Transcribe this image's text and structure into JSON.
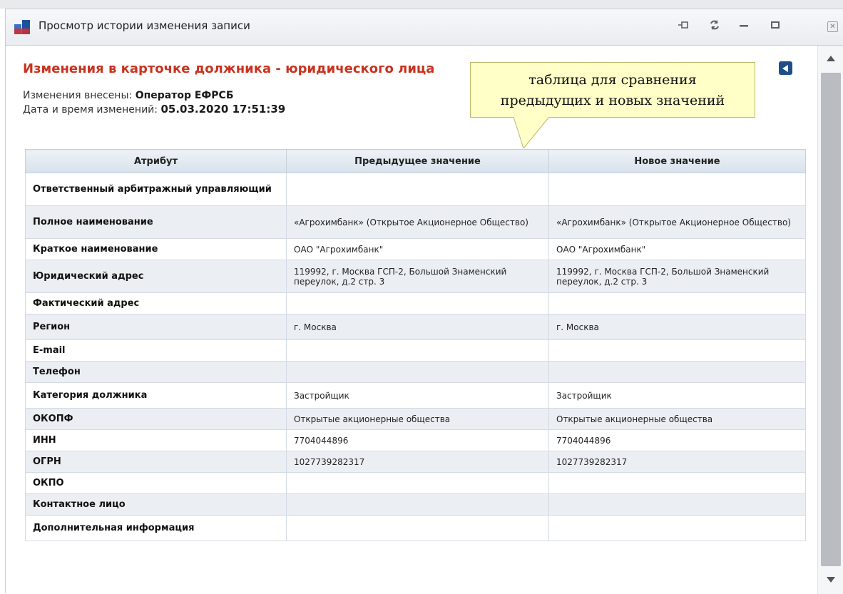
{
  "window": {
    "title": "Просмотр истории изменения записи",
    "buttons": [
      "pin-icon",
      "refresh-icon",
      "minimize-icon",
      "maximize-icon",
      "close-icon"
    ]
  },
  "content": {
    "heading": "Изменения в карточке должника - юридического лица",
    "changed_by_label": "Изменения внесены:",
    "changed_by_value": "Оператор ЕФРСБ",
    "datetime_label": "Дата и время изменений:",
    "datetime_value": "05.03.2020 17:51:39"
  },
  "callout": {
    "line1": "таблица для сравнения",
    "line2": "предыдущих и новых значений"
  },
  "table": {
    "headers": [
      "Атрибут",
      "Предыдущее значение",
      "Новое значение"
    ],
    "rows": [
      {
        "attr": "Ответственный арбитражный управляющий",
        "prev": "",
        "new": ""
      },
      {
        "attr": "Полное наименование",
        "prev": "«Агрохимбанк» (Открытое Акционерное Общество)",
        "new": "«Агрохимбанк» (Открытое Акционерное Общество)"
      },
      {
        "attr": "Краткое наименование",
        "prev": "ОАО \"Агрохимбанк\"",
        "new": "ОАО \"Агрохимбанк\""
      },
      {
        "attr": "Юридический адрес",
        "prev": "119992, г. Москва ГСП-2, Большой Знаменский переулок, д.2 стр. 3",
        "new": "119992, г. Москва ГСП-2, Большой Знаменский переулок, д.2 стр. 3"
      },
      {
        "attr": "Фактический адрес",
        "prev": "",
        "new": ""
      },
      {
        "attr": "Регион",
        "prev": "г. Москва",
        "new": "г. Москва"
      },
      {
        "attr": "E-mail",
        "prev": "",
        "new": ""
      },
      {
        "attr": "Телефон",
        "prev": "",
        "new": ""
      },
      {
        "attr": "Категория должника",
        "prev": "Застройщик",
        "new": "Застройщик"
      },
      {
        "attr": "ОКОПФ",
        "prev": "Открытые акционерные общества",
        "new": "Открытые акционерные общества"
      },
      {
        "attr": "ИНН",
        "prev": "7704044896",
        "new": "7704044896"
      },
      {
        "attr": "ОГРН",
        "prev": "1027739282317",
        "new": "1027739282317"
      },
      {
        "attr": "ОКПО",
        "prev": "",
        "new": ""
      },
      {
        "attr": "Контактное лицо",
        "prev": "",
        "new": ""
      },
      {
        "attr": "Дополнительная информация",
        "prev": "",
        "new": ""
      }
    ]
  }
}
